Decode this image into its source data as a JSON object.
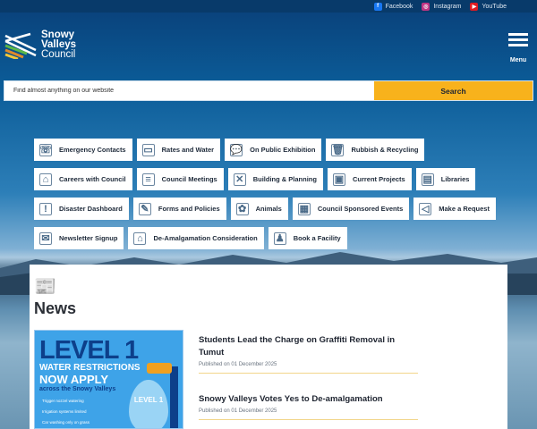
{
  "social": [
    {
      "label": "Facebook",
      "icon": "facebook-icon",
      "color": "#1877f2",
      "glyph": "f"
    },
    {
      "label": "Instagram",
      "icon": "instagram-icon",
      "color": "#c13584",
      "glyph": "◎"
    },
    {
      "label": "YouTube",
      "icon": "youtube-icon",
      "color": "#e01b22",
      "glyph": "▶"
    }
  ],
  "logo": {
    "line1": "Snowy",
    "line2": "Valleys",
    "line3": "Council"
  },
  "menu": {
    "label": "Menu"
  },
  "search": {
    "placeholder": "Find almost anything on our website",
    "button": "Search"
  },
  "tiles": [
    [
      {
        "label": "Emergency Contacts",
        "g": "☏"
      },
      {
        "label": "Rates and Water",
        "g": "▭"
      },
      {
        "label": "On Public Exhibition",
        "g": "💬"
      },
      {
        "label": "Rubbish & Recycling",
        "g": "🗑"
      }
    ],
    [
      {
        "label": "Careers with Council",
        "g": "⌂"
      },
      {
        "label": "Council Meetings",
        "g": "≡"
      },
      {
        "label": "Building & Planning",
        "g": "✕"
      },
      {
        "label": "Current Projects",
        "g": "▣"
      },
      {
        "label": "Libraries",
        "g": "▤"
      }
    ],
    [
      {
        "label": "Disaster Dashboard",
        "g": "!"
      },
      {
        "label": "Forms and Policies",
        "g": "✎"
      },
      {
        "label": "Animals",
        "g": "✿"
      },
      {
        "label": "Council Sponsored Events",
        "g": "▦"
      },
      {
        "label": "Make a Request",
        "g": "◁"
      }
    ],
    [
      {
        "label": "Newsletter Signup",
        "g": "✉"
      },
      {
        "label": "De-Amalgamation Consideration",
        "g": "⌂"
      },
      {
        "label": "Book a Facility",
        "g": "♟"
      }
    ]
  ],
  "news": {
    "heading": "News",
    "image": {
      "line1": "LEVEL 1",
      "line2": "WATER RESTRICTIONS",
      "line3": "NOW APPLY",
      "line4": "across the Snowy Valleys",
      "rules": [
        "Trigger nozzel watering",
        "Irrigation systems limited",
        "Car washing only on grass"
      ],
      "drop": "LEVEL 1"
    },
    "articles": [
      {
        "title": "Students Lead the Charge on Graffiti Removal in Tumut",
        "date": "Published on 01 December 2025"
      },
      {
        "title": "Snowy Valleys Votes Yes to De-amalgamation",
        "date": "Published on 01 December 2025"
      }
    ]
  }
}
